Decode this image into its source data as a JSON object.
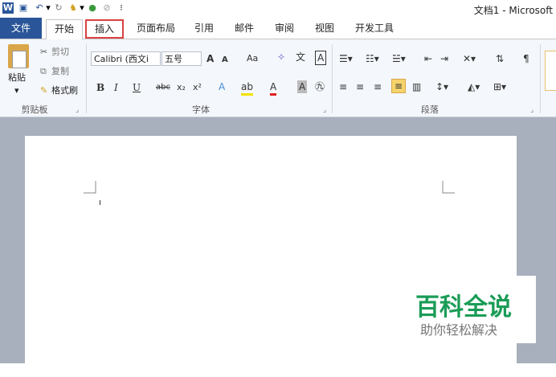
{
  "qat": {
    "icons": [
      "word-icon",
      "save-icon",
      "undo-icon",
      "redo-icon",
      "format-painter-icon",
      "color-icon",
      "clear-icon",
      "customize-icon"
    ]
  },
  "title": "文档1 - Microsoft",
  "tabs": [
    "文件",
    "开始",
    "插入",
    "页面布局",
    "引用",
    "邮件",
    "审阅",
    "视图",
    "开发工具"
  ],
  "clipboard": {
    "paste": "粘贴",
    "cut": "剪切",
    "copy": "复制",
    "format_painter": "格式刷",
    "label": "剪贴板"
  },
  "font": {
    "font_name": "Calibri (西文i",
    "font_size": "五号",
    "label": "字体",
    "buttons": [
      "A",
      "A",
      "Aa",
      "B",
      "I",
      "U",
      "abc",
      "x₂",
      "x²"
    ]
  },
  "paragraph": {
    "label": "段落"
  },
  "watermark": {
    "main": "百科全说",
    "sub": "助你轻松解决"
  },
  "colors": {
    "file_tab": "#2a5699",
    "highlight": "#d94242",
    "watermark": "#1a9c57"
  }
}
